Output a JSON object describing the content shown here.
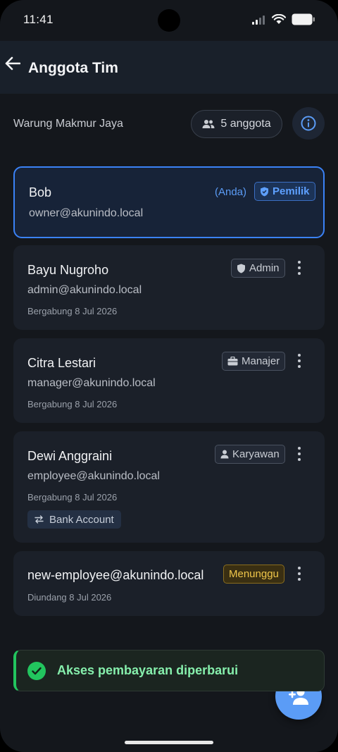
{
  "status_bar": {
    "time": "11:41"
  },
  "app_bar": {
    "title": "Anggota Tim"
  },
  "toolbar": {
    "store_name": "Warung Makmur Jaya",
    "member_count": "5 anggota"
  },
  "members": [
    {
      "name": "Bob",
      "email": "owner@akunindo.local",
      "you_label": "(Anda)",
      "badge": "Pemilik"
    },
    {
      "name": "Bayu Nugroho",
      "email": "admin@akunindo.local",
      "badge": "Admin",
      "joined": "Bergabung 8 Jul 2026"
    },
    {
      "name": "Citra Lestari",
      "email": "manager@akunindo.local",
      "badge": "Manajer",
      "joined": "Bergabung 8 Jul 2026"
    },
    {
      "name": "Dewi Anggraini",
      "email": "employee@akunindo.local",
      "badge": "Karyawan",
      "joined": "Bergabung 8 Jul 2026",
      "access_chip": "Bank Account"
    },
    {
      "name": "new-employee@akunindo.local",
      "badge": "Menunggu",
      "joined": "Diundang 8 Jul 2026"
    }
  ],
  "toast": {
    "message": "Akses pembayaran diperbarui"
  },
  "colors": {
    "accent": "#3b82f6",
    "success": "#22c55e",
    "pending": "#f0c64a",
    "fab": "#5b9cf6"
  },
  "icons": [
    "back-arrow-icon",
    "users-icon",
    "info-icon",
    "shield-icon",
    "briefcase-icon",
    "person-icon",
    "transfer-icon",
    "more-vertical-icon",
    "check-circle-icon",
    "add-user-icon"
  ]
}
